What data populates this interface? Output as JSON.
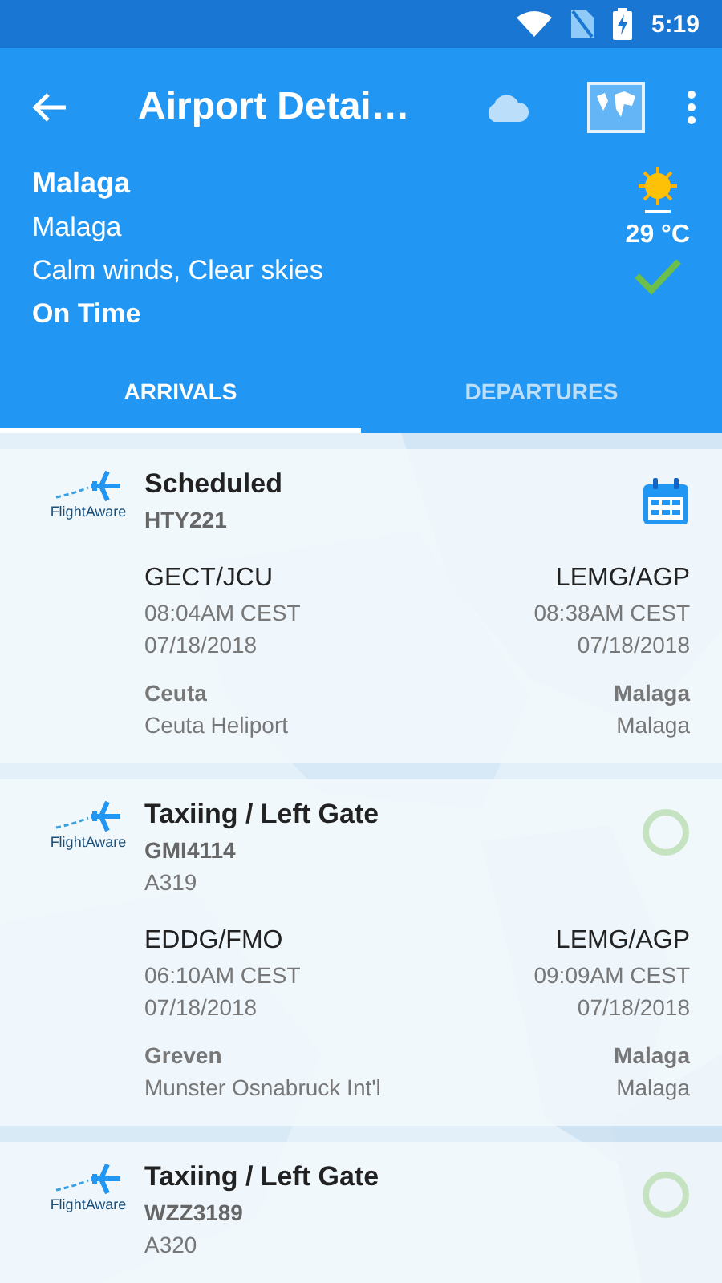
{
  "status_bar": {
    "time": "5:19"
  },
  "app_bar": {
    "title": "Airport Detai…"
  },
  "airport": {
    "name": "Malaga",
    "city": "Malaga",
    "conditions": "Calm winds, Clear skies",
    "status": "On Time",
    "temperature": "29 °C",
    "on_time": true
  },
  "tabs": [
    {
      "label": "ARRIVALS",
      "selected": true
    },
    {
      "label": "DEPARTURES",
      "selected": false
    }
  ],
  "flights": [
    {
      "kind": "scheduled",
      "logo_text": "FlightAware",
      "status": "Scheduled",
      "flight": "HTY221",
      "origin": {
        "code": "GECT/JCU",
        "time": "08:04AM CEST",
        "date": "07/18/2018",
        "city": "Ceuta",
        "airport": "Ceuta Heliport"
      },
      "destination": {
        "code": "LEMG/AGP",
        "time": "08:38AM CEST",
        "date": "07/18/2018",
        "city": "Malaga",
        "airport": "Malaga"
      }
    },
    {
      "kind": "taxiing",
      "logo_text": "FlightAware",
      "status": "Taxiing / Left Gate",
      "flight": "GMI4114",
      "aircraft": "A319",
      "origin": {
        "code": "EDDG/FMO",
        "time": "06:10AM CEST",
        "date": "07/18/2018",
        "city": "Greven",
        "airport": "Munster Osnabruck Int'l"
      },
      "destination": {
        "code": "LEMG/AGP",
        "time": "09:09AM CEST",
        "date": "07/18/2018",
        "city": "Malaga",
        "airport": "Malaga"
      }
    },
    {
      "kind": "taxiing",
      "logo_text": "FlightAware",
      "status": "Taxiing / Left Gate",
      "flight": "WZZ3189",
      "aircraft": "A320"
    }
  ]
}
